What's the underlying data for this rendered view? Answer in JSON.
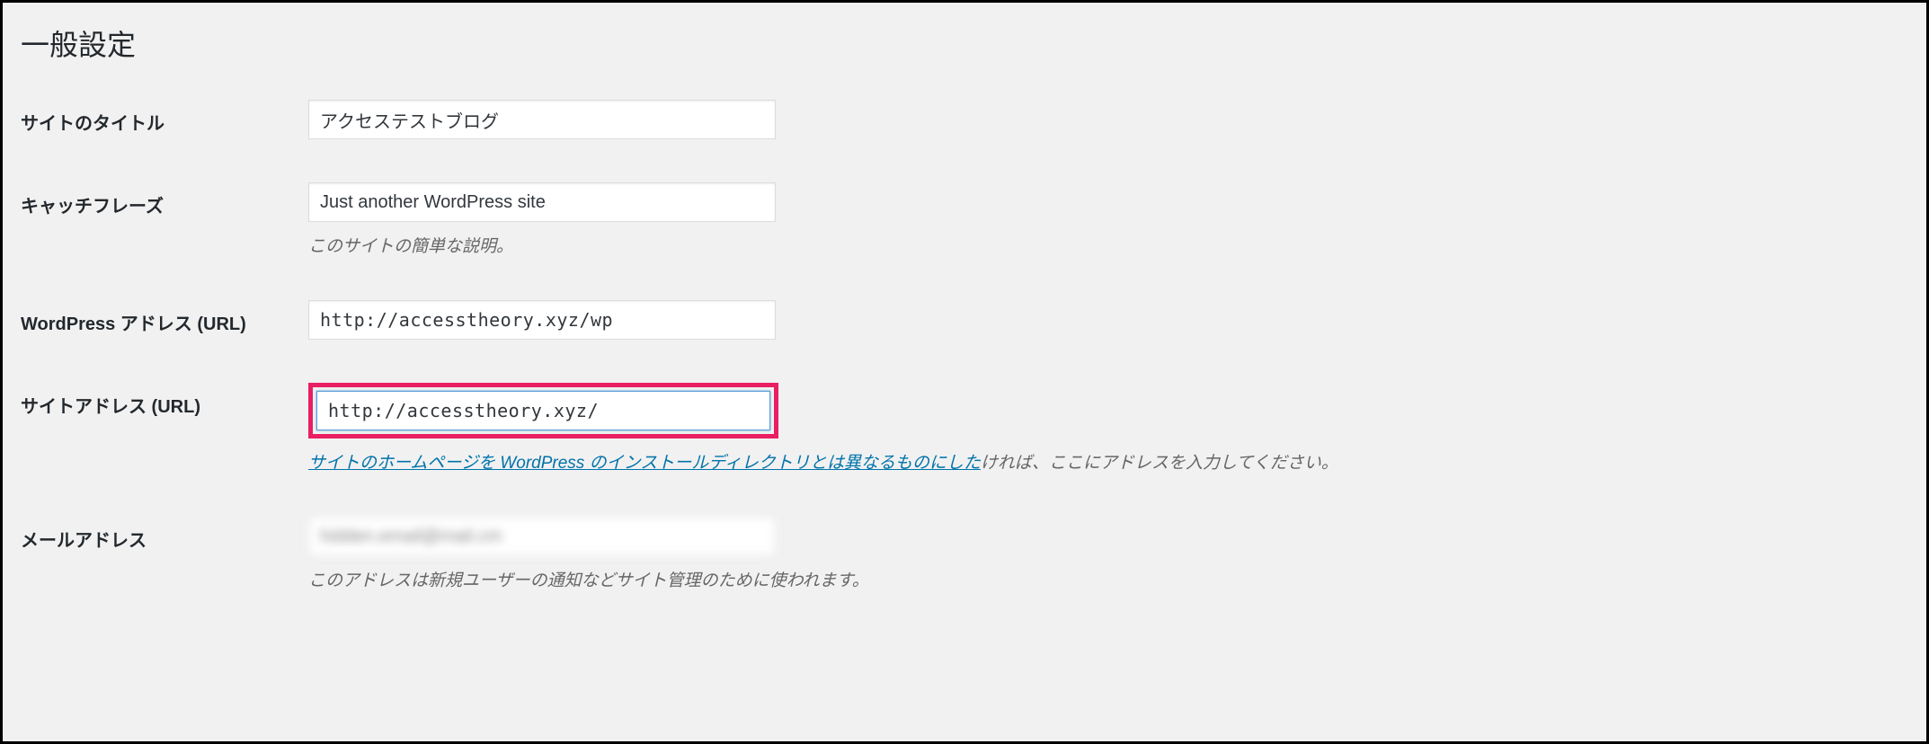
{
  "page_title": "一般設定",
  "fields": {
    "site_title": {
      "label": "サイトのタイトル",
      "value": "アクセステストブログ"
    },
    "tagline": {
      "label": "キャッチフレーズ",
      "value": "Just another WordPress site",
      "description": "このサイトの簡単な説明。"
    },
    "wp_url": {
      "label": "WordPress アドレス (URL)",
      "value": "http://accesstheory.xyz/wp"
    },
    "site_url": {
      "label": "サイトアドレス (URL)",
      "value": "http://accesstheory.xyz/",
      "description_link": "サイトのホームページを WordPress のインストールディレクトリとは異なるものにした",
      "description_rest": "ければ、ここにアドレスを入力してください。"
    },
    "email": {
      "label": "メールアドレス",
      "value": "hidden.email@mail.cm",
      "description": "このアドレスは新規ユーザーの通知などサイト管理のために使われます。"
    }
  }
}
